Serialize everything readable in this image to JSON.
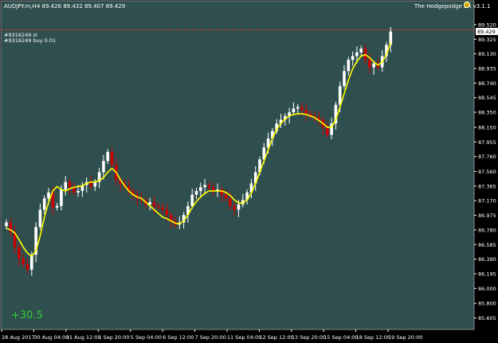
{
  "header": {
    "symbol_info": "AUDJPY.m,H4  89.426 89.432 89.407 89.429",
    "ea_name": "The Hodgepodge EA  v3.1.1"
  },
  "orders": {
    "line1": "#9316249 sl",
    "line2": "#9316249 buy 0.01"
  },
  "profit_label": "+30.5",
  "colors": {
    "background": "#2f4f4f",
    "bull": "#ffffff",
    "bear": "#cc0000",
    "ma": "#ffff00",
    "order_line": "#cc3333",
    "profit": "#33cc33"
  },
  "icons": [
    "smiley-icon"
  ],
  "chart_data": {
    "type": "candlestick",
    "title": "AUDJPY.m,H4",
    "current_price": 89.429,
    "order_line_price": 89.45,
    "ylim": [
      85.6,
      89.7
    ],
    "price_ticks": [
      "89.520",
      "89.325",
      "89.130",
      "88.935",
      "88.740",
      "88.545",
      "88.350",
      "88.150",
      "87.955",
      "87.760",
      "87.560",
      "87.365",
      "87.170",
      "86.975",
      "86.780",
      "86.585",
      "86.390",
      "86.195",
      "86.000",
      "85.800",
      "85.605"
    ],
    "time_ticks": [
      "28 Aug 2017",
      "30 Aug 04:00",
      "31 Aug 12:00",
      "1 Sep 20:00",
      "5 Sep 04:00",
      "6 Sep 12:00",
      "7 Sep 20:00",
      "11 Sep 04:00",
      "12 Sep 12:00",
      "13 Sep 20:00",
      "15 Sep 04:00",
      "18 Sep 12:00",
      "19 Sep 20:00"
    ],
    "closes": [
      86.88,
      86.75,
      86.55,
      86.4,
      86.32,
      86.25,
      86.45,
      86.82,
      87.05,
      87.2,
      87.28,
      87.08,
      87.1,
      87.32,
      87.42,
      87.35,
      87.28,
      87.3,
      87.38,
      87.42,
      87.36,
      87.42,
      87.55,
      87.7,
      87.82,
      87.65,
      87.45,
      87.4,
      87.36,
      87.3,
      87.25,
      87.2,
      87.18,
      87.12,
      87.15,
      87.1,
      87.08,
      87.05,
      86.98,
      86.9,
      86.85,
      86.88,
      86.98,
      87.1,
      87.25,
      87.3,
      87.35,
      87.38,
      87.35,
      87.3,
      87.32,
      87.25,
      87.2,
      87.1,
      87.05,
      87.12,
      87.18,
      87.28,
      87.4,
      87.55,
      87.72,
      87.88,
      88.0,
      88.1,
      88.2,
      88.25,
      88.3,
      88.35,
      88.4,
      88.42,
      88.38,
      88.33,
      88.3,
      88.28,
      88.25,
      88.15,
      88.05,
      88.2,
      88.45,
      88.7,
      88.9,
      89.05,
      89.1,
      89.15,
      89.2,
      89.05,
      88.95,
      89.0,
      88.95,
      89.1,
      89.25,
      89.429
    ],
    "ma_values": [
      86.8,
      86.78,
      86.74,
      86.65,
      86.55,
      86.47,
      86.43,
      86.5,
      86.7,
      86.95,
      87.15,
      87.3,
      87.36,
      87.32,
      87.3,
      87.33,
      87.35,
      87.36,
      87.37,
      87.4,
      87.42,
      87.42,
      87.44,
      87.48,
      87.55,
      87.6,
      87.55,
      87.45,
      87.37,
      87.3,
      87.25,
      87.22,
      87.2,
      87.15,
      87.1,
      87.05,
      87.0,
      86.95,
      86.93,
      86.9,
      86.87,
      86.86,
      86.9,
      86.98,
      87.08,
      87.16,
      87.22,
      87.27,
      87.3,
      87.3,
      87.3,
      87.3,
      87.28,
      87.24,
      87.18,
      87.14,
      87.14,
      87.18,
      87.27,
      87.4,
      87.55,
      87.7,
      87.85,
      88.0,
      88.12,
      88.2,
      88.26,
      88.3,
      88.32,
      88.33,
      88.33,
      88.32,
      88.3,
      88.28,
      88.24,
      88.2,
      88.15,
      88.15,
      88.25,
      88.42,
      88.6,
      88.78,
      88.93,
      89.03,
      89.1,
      89.12,
      89.08,
      89.02,
      88.98,
      89.02,
      89.12,
      89.28
    ]
  }
}
